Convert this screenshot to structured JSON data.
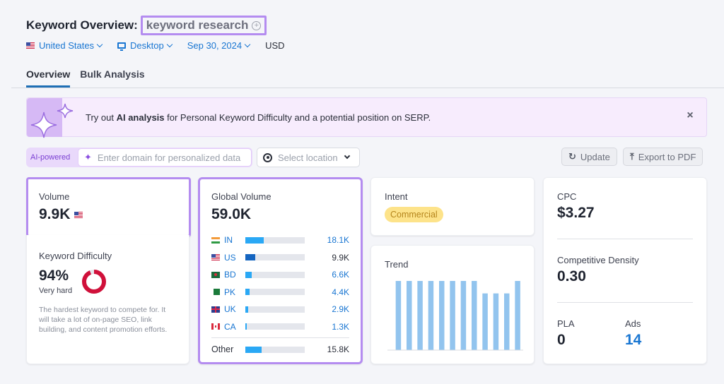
{
  "header": {
    "title": "Keyword Overview:",
    "keyword": "keyword research",
    "add_icon": "plus-circle-icon",
    "filters": {
      "country": "United States",
      "device": "Desktop",
      "date": "Sep 30, 2024",
      "currency": "USD"
    }
  },
  "tabs": [
    {
      "label": "Overview",
      "active": true
    },
    {
      "label": "Bulk Analysis",
      "active": false
    }
  ],
  "banner": {
    "prefix": "Try out ",
    "bold": "AI analysis",
    "suffix": " for Personal Keyword Difficulty and a potential position on SERP.",
    "close_icon": "close-icon"
  },
  "toolbar": {
    "ai_label": "AI-powered",
    "domain_placeholder": "Enter domain for personalized data",
    "location_placeholder": "Select location",
    "update_label": "Update",
    "export_label": "Export to PDF"
  },
  "volume": {
    "label": "Volume",
    "value": "9.9K",
    "flag": "us-flag-icon"
  },
  "keyword_difficulty": {
    "label": "Keyword Difficulty",
    "value": "94%",
    "percent": 94,
    "level": "Very hard",
    "description": "The hardest keyword to compete for. It will take a lot of on-page SEO, link building, and content promotion efforts.",
    "color": "#d0103a"
  },
  "global_volume": {
    "label": "Global Volume",
    "value": "59.0K",
    "countries": [
      {
        "code": "IN",
        "flag": "f-in",
        "value": "18.1K",
        "share": 0.307,
        "highlight": false
      },
      {
        "code": "US",
        "flag": "f-us",
        "value": "9.9K",
        "share": 0.168,
        "highlight": true
      },
      {
        "code": "BD",
        "flag": "f-bd",
        "value": "6.6K",
        "share": 0.112,
        "highlight": false
      },
      {
        "code": "PK",
        "flag": "f-pk",
        "value": "4.4K",
        "share": 0.075,
        "highlight": false
      },
      {
        "code": "UK",
        "flag": "f-uk",
        "value": "2.9K",
        "share": 0.049,
        "highlight": false
      },
      {
        "code": "CA",
        "flag": "f-ca",
        "value": "1.3K",
        "share": 0.022,
        "highlight": false
      }
    ],
    "other": {
      "label": "Other",
      "value": "15.8K",
      "share": 0.268
    }
  },
  "intent": {
    "label": "Intent",
    "badge": "Commercial"
  },
  "trend": {
    "label": "Trend",
    "values": [
      100,
      100,
      100,
      100,
      100,
      100,
      100,
      100,
      82,
      82,
      82,
      100
    ],
    "bar_color": "#92c4ee"
  },
  "cpc": {
    "label": "CPC",
    "value": "$3.27",
    "density_label": "Competitive Density",
    "density_value": "0.30",
    "pla_label": "PLA",
    "pla_value": "0",
    "ads_label": "Ads",
    "ads_value": "14"
  }
}
